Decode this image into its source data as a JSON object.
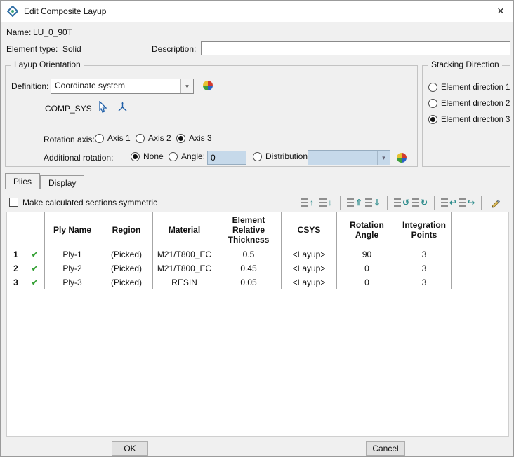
{
  "window": {
    "title": "Edit Composite Layup"
  },
  "header": {
    "name_label": "Name:",
    "name_value": "LU_0_90T",
    "element_type_label": "Element type:",
    "element_type_value": "Solid",
    "description_label": "Description:",
    "description_value": ""
  },
  "layup_orientation": {
    "title": "Layup Orientation",
    "definition_label": "Definition:",
    "definition_value": "Coordinate system",
    "csys_name": "COMP_SYS",
    "rotation_axis_label": "Rotation axis:",
    "axis_options": [
      "Axis 1",
      "Axis 2",
      "Axis 3"
    ],
    "axis_selected": "Axis 3",
    "additional_rotation_label": "Additional rotation:",
    "option_none": "None",
    "option_angle": "Angle:",
    "angle_value": "0",
    "option_distribution": "Distribution:",
    "distribution_value": "",
    "additional_selected": "None"
  },
  "stacking_direction": {
    "title": "Stacking Direction",
    "options": [
      "Element direction 1",
      "Element direction 2",
      "Element direction 3"
    ],
    "selected": "Element direction 3"
  },
  "tabs": [
    {
      "label": "Plies",
      "active": true
    },
    {
      "label": "Display",
      "active": false
    }
  ],
  "plies_tab": {
    "symmetric_label": "Make calculated sections symmetric",
    "symmetric_checked": false,
    "toolbar_icon_names": [
      "move-ply-up",
      "move-ply-down",
      "insert-ply-above",
      "insert-ply-below",
      "cycle-plies-up",
      "cycle-plies-down",
      "send-plies-back",
      "bring-plies-front",
      "edit-ply"
    ],
    "table": {
      "headers": {
        "ply_name": "Ply Name",
        "region": "Region",
        "material": "Material",
        "thickness": "Element Relative Thickness",
        "csys": "CSYS",
        "rotation": "Rotation Angle",
        "integration": "Integration Points"
      },
      "rows": [
        {
          "num": "1",
          "check": "✔",
          "ply_name": "Ply-1",
          "region": "(Picked)",
          "material": "M21/T800_EC",
          "thickness": "0.5",
          "csys": "<Layup>",
          "rotation": "90",
          "integration": "3"
        },
        {
          "num": "2",
          "check": "✔",
          "ply_name": "Ply-2",
          "region": "(Picked)",
          "material": "M21/T800_EC",
          "thickness": "0.45",
          "csys": "<Layup>",
          "rotation": "0",
          "integration": "3"
        },
        {
          "num": "3",
          "check": "✔",
          "ply_name": "Ply-3",
          "region": "(Picked)",
          "material": "RESIN",
          "thickness": "0.05",
          "csys": "<Layup>",
          "rotation": "0",
          "integration": "3"
        }
      ]
    }
  },
  "footer": {
    "ok_label": "OK",
    "cancel_label": "Cancel"
  },
  "icons": {
    "close": "×",
    "combo_arrow": "▾",
    "move_up": "↑",
    "move_down": "↓",
    "insert_above": "⇑",
    "insert_below": "⇓",
    "cycle_up": "↺",
    "cycle_down": "↻",
    "send_back": "↩",
    "bring_front": "↪"
  },
  "colors": {
    "disabled_field_bg": "#c6d9ea",
    "check_green": "#2f9e2f",
    "dialog_bg": "#f0f0f0"
  }
}
